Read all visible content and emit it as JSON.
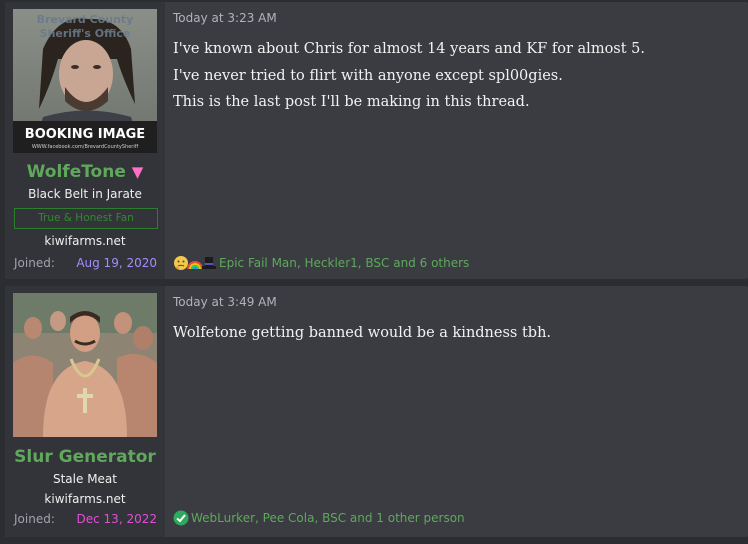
{
  "posts": [
    {
      "username": "WolfeTone",
      "username_badge": "▼",
      "user_title": "Black Belt in Jarate",
      "user_banner": "True & Honest Fan",
      "user_extra": "kiwifarms.net",
      "joined_label": "Joined:",
      "joined_date": "Aug 19, 2020",
      "joined_color": "#a58bff",
      "avatar_text_top": "Brevard County Sheriff's Office",
      "avatar_text_bottom": "BOOKING IMAGE",
      "avatar_text_url": "WWW.facebook.com/BrevardCountySheriff",
      "timestamp": "Today at 3:23 AM",
      "body_lines": [
        "I've known about Chris for almost 14 years and KF for almost 5.",
        "I've never tried to flirt with anyone except spl00gies.",
        "This is the last post I'll be making in this thread."
      ],
      "reaction_icons": [
        "thinking-icon",
        "rainbow-icon",
        "hat-icon"
      ],
      "reactions_text": "Epic Fail Man, Heckler1, BSC and 6 others"
    },
    {
      "username": "Slur Generator",
      "user_title": "Stale Meat",
      "user_extra": "kiwifarms.net",
      "joined_label": "Joined:",
      "joined_date": "Dec 13, 2022",
      "joined_color": "#e24fd6",
      "timestamp": "Today at 3:49 AM",
      "body_lines": [
        "Wolfetone getting banned would be a kindness tbh."
      ],
      "reaction_icons": [
        "check-icon"
      ],
      "reactions_text": "WebLurker, Pee Cola, BSC and 1 other person"
    }
  ]
}
